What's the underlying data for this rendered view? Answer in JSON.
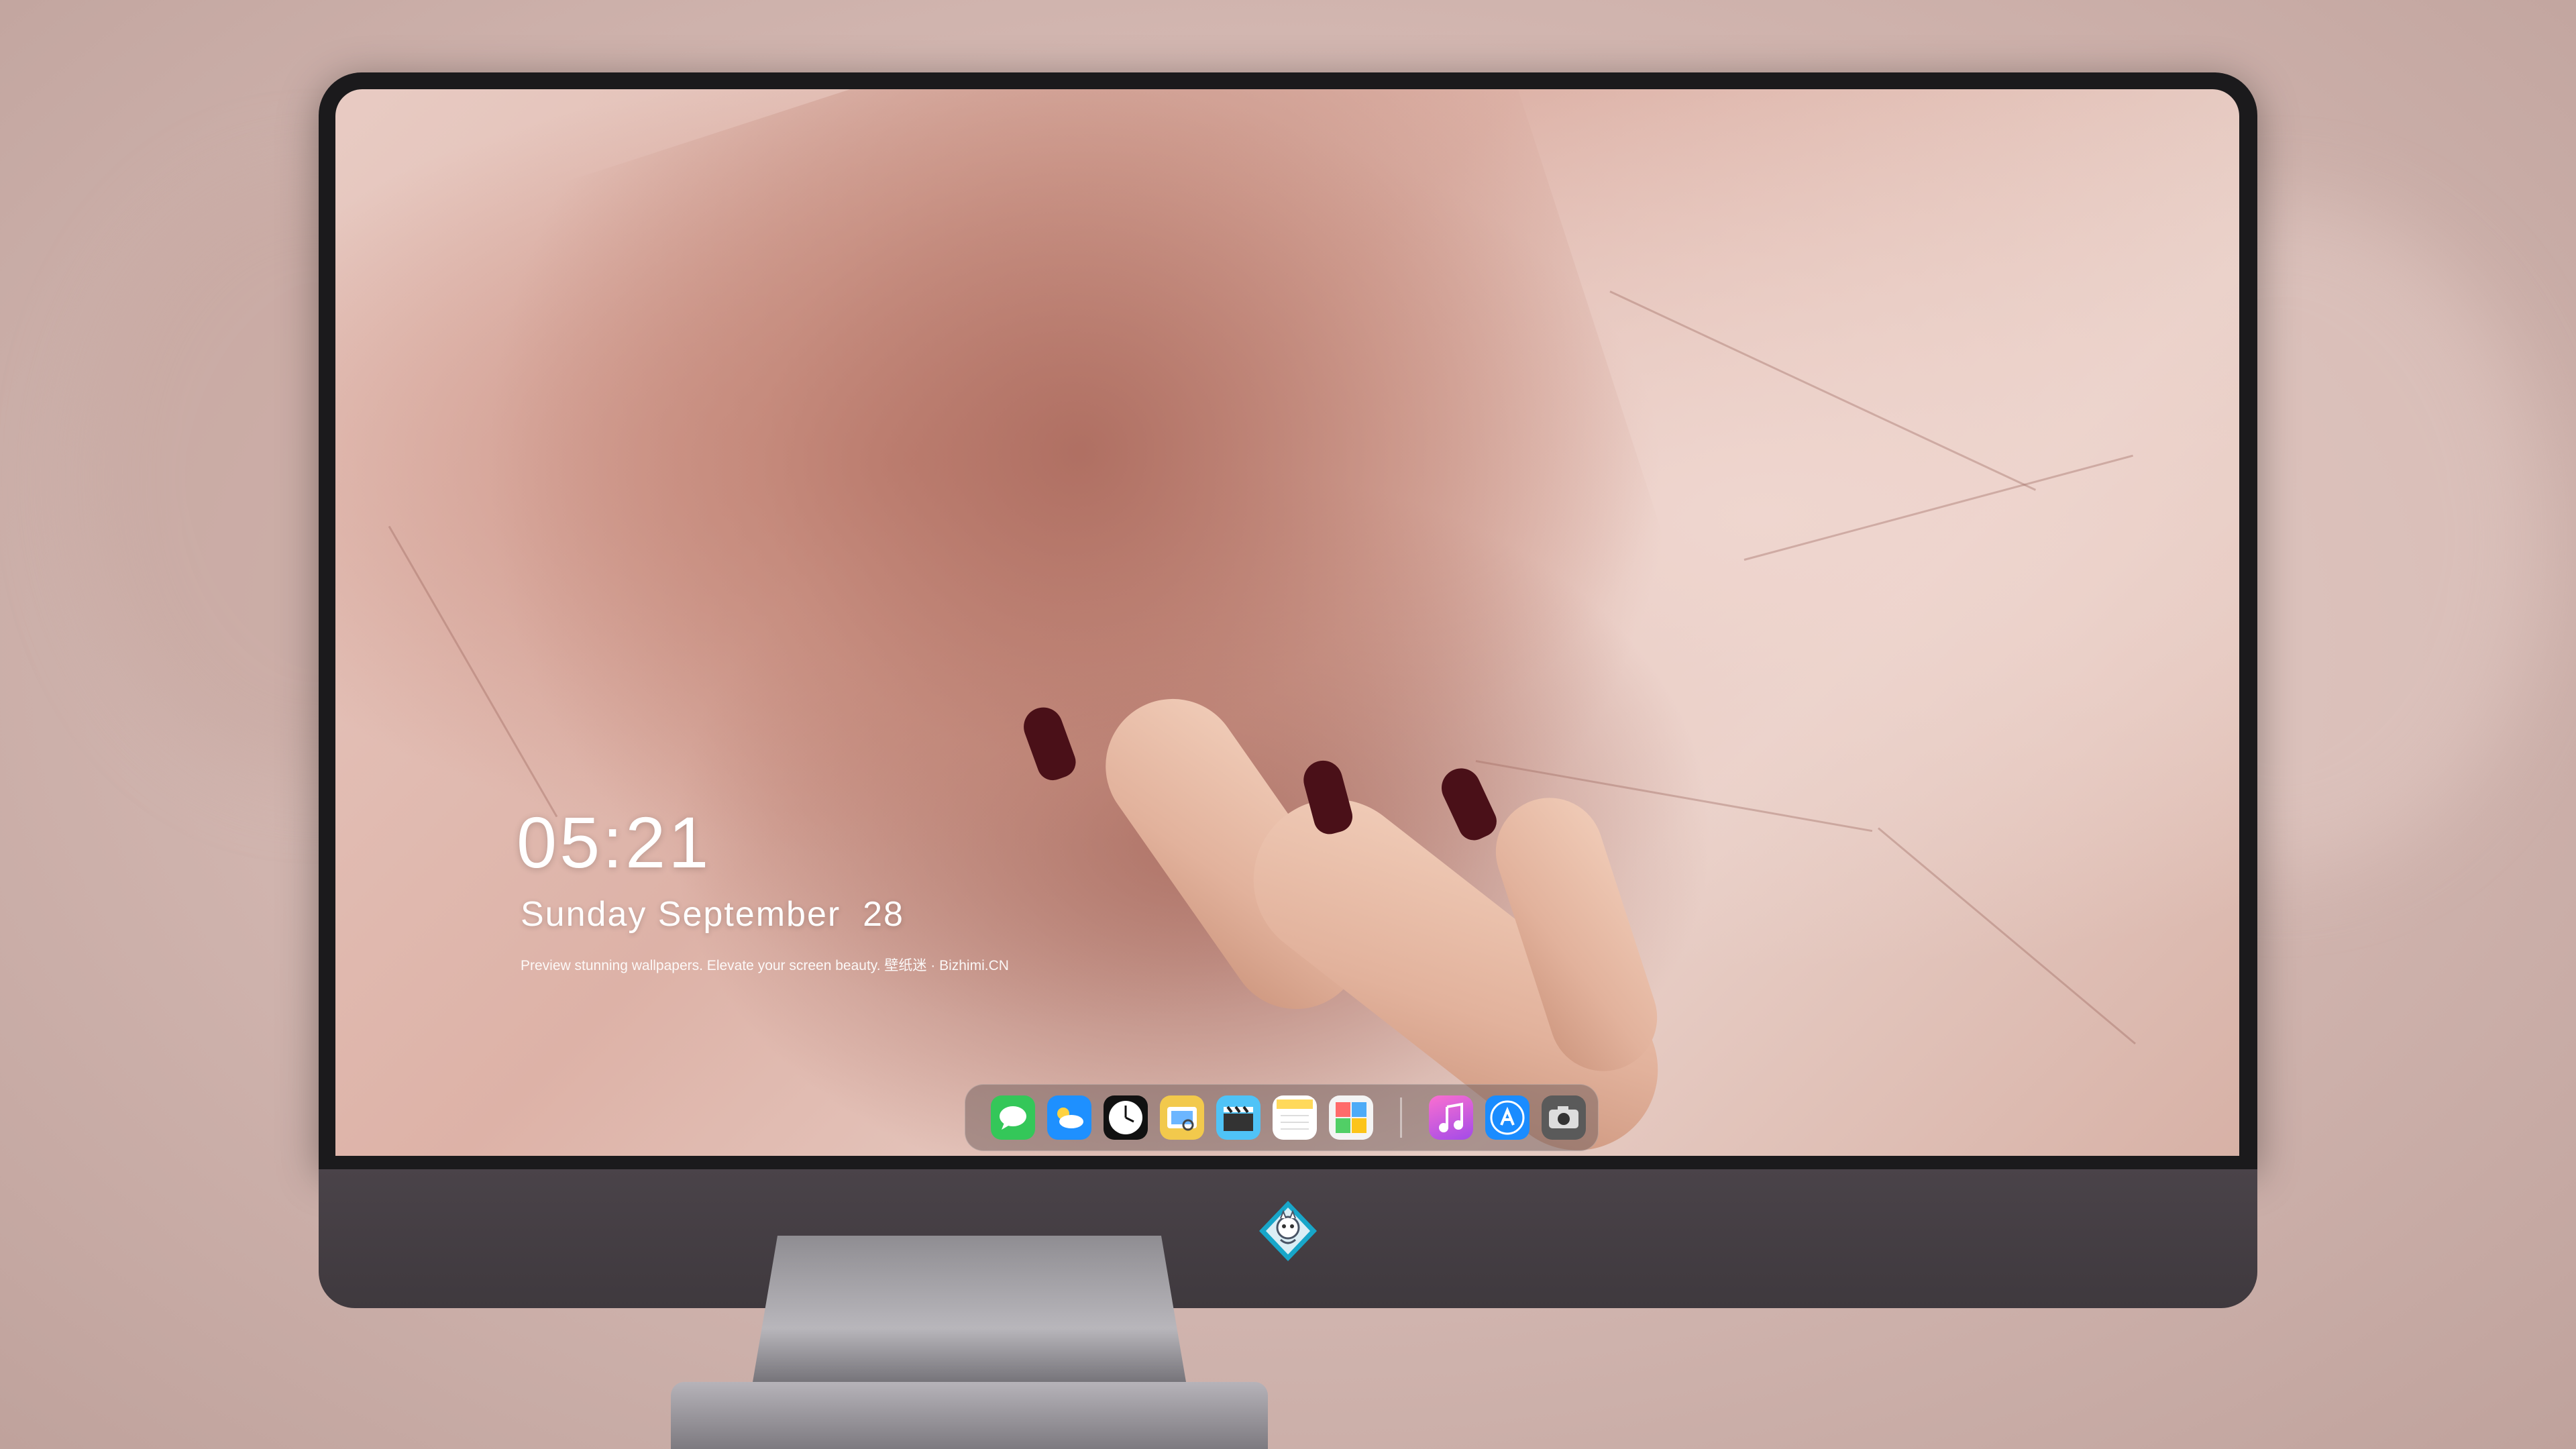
{
  "lock_screen": {
    "time": "05:21",
    "date": "Sunday September  28",
    "tagline": "Preview stunning wallpapers. Elevate your screen beauty. 壁纸迷 · Bizhimi.CN"
  },
  "dock": {
    "apps": [
      {
        "name": "messages",
        "icon": "message-bubble-icon",
        "color": "#34c759"
      },
      {
        "name": "weather",
        "icon": "cloud-icon",
        "color": "#1e90ff"
      },
      {
        "name": "clock",
        "icon": "clock-icon",
        "color": "#111111"
      },
      {
        "name": "preview",
        "icon": "image-viewer-icon",
        "color": "#f2c94c"
      },
      {
        "name": "clips",
        "icon": "clapperboard-icon",
        "color": "#4fc3f7"
      },
      {
        "name": "notes",
        "icon": "notes-icon",
        "color": "#ffd95a"
      },
      {
        "name": "photo-booth",
        "icon": "photo-collage-icon",
        "color": "#f4f4f4"
      },
      {
        "name": "music",
        "icon": "music-note-icon",
        "color": "#d34bd8"
      },
      {
        "name": "app-store",
        "icon": "app-store-icon",
        "color": "#1a8cff"
      },
      {
        "name": "camera",
        "icon": "camera-icon",
        "color": "#5a5a5a"
      }
    ]
  },
  "colors": {
    "bezel": "#1b1a1c",
    "chin": "#433c42",
    "accent_nail": "#4a1018",
    "text": "#ffffff"
  }
}
